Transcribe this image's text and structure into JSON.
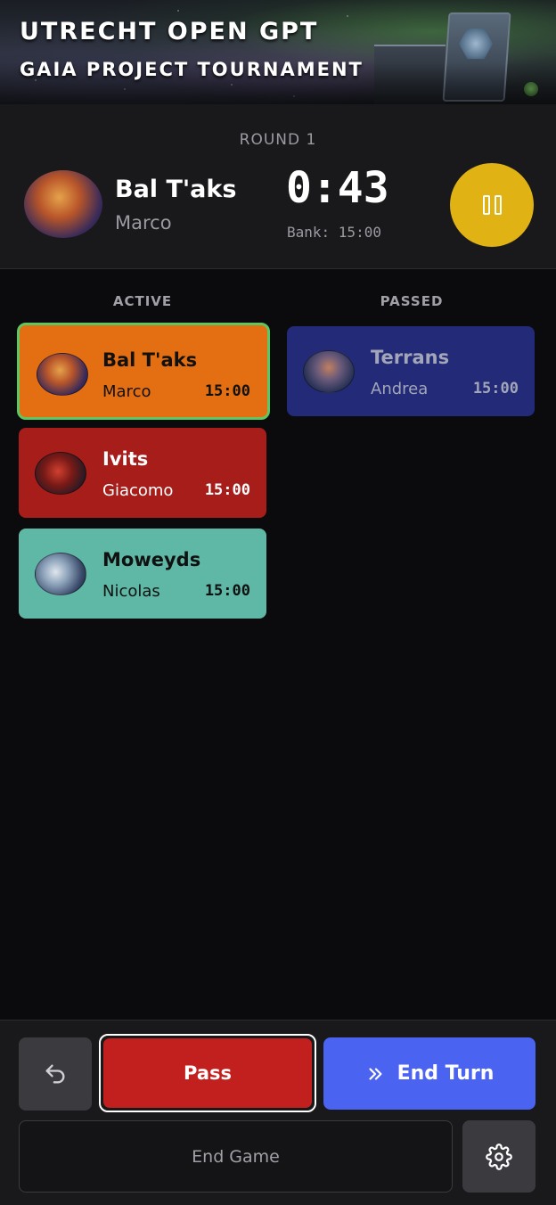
{
  "banner": {
    "title_line1": "UTRECHT OPEN GPT",
    "title_line2": "GAIA PROJECT TOURNAMENT"
  },
  "header": {
    "round_label": "ROUND 1",
    "current_faction": "Bal T'aks",
    "current_player": "Marco",
    "turn_timer": "0:43",
    "bank_label": "Bank: 15:00",
    "pause_icon": "pause-icon",
    "pause_color": "#e0b214"
  },
  "columns": {
    "active_title": "ACTIVE",
    "passed_title": "PASSED"
  },
  "active_players": [
    {
      "faction": "Bal T'aks",
      "player": "Marco",
      "time": "15:00",
      "color": "#e46f12",
      "current": true
    },
    {
      "faction": "Ivits",
      "player": "Giacomo",
      "time": "15:00",
      "color": "#a61d1a"
    },
    {
      "faction": "Moweyds",
      "player": "Nicolas",
      "time": "15:00",
      "color": "#5fb8a6"
    }
  ],
  "passed_players": [
    {
      "faction": "Terrans",
      "player": "Andrea",
      "time": "15:00",
      "color": "#232a78"
    }
  ],
  "actions": {
    "undo_icon": "undo-icon",
    "pass_label": "Pass",
    "pass_color": "#c21f1f",
    "end_turn_label": "End Turn",
    "end_turn_icon": "chevrons-right-icon",
    "end_turn_color": "#4a63f0",
    "end_game_label": "End Game",
    "settings_icon": "gear-icon"
  }
}
